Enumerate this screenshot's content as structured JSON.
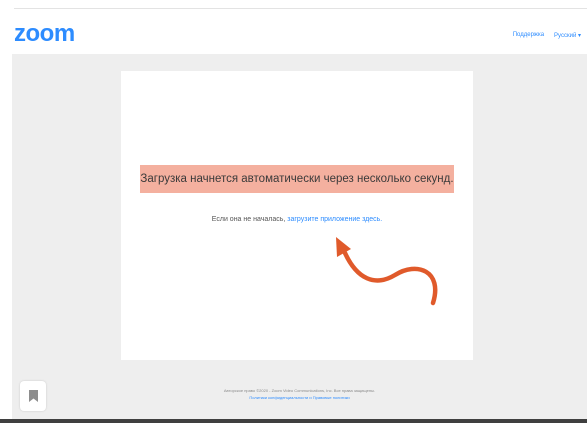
{
  "header": {
    "logo_text": "zoom",
    "links": [
      "Поддержка",
      "Русский ▾"
    ]
  },
  "card": {
    "headline": "Загрузка начнется автоматически через несколько секунд.",
    "subline_prefix": "Если она не началась,",
    "subline_link": "загрузите приложение здесь."
  },
  "footer": {
    "copyright": "Авторское право ©2020 - Zoom Video Communications, Inc. Все права защищены.",
    "policies": "Политики конфиденциальности и Правовые политики"
  },
  "icons": {
    "bookmark": "bookmark-icon",
    "annotation": "curved-arrow-icon"
  },
  "colors": {
    "brand": "#2d8cff",
    "highlight": "#f4b09f",
    "arrow": "#e05a2b",
    "background": "#eeeeee"
  }
}
